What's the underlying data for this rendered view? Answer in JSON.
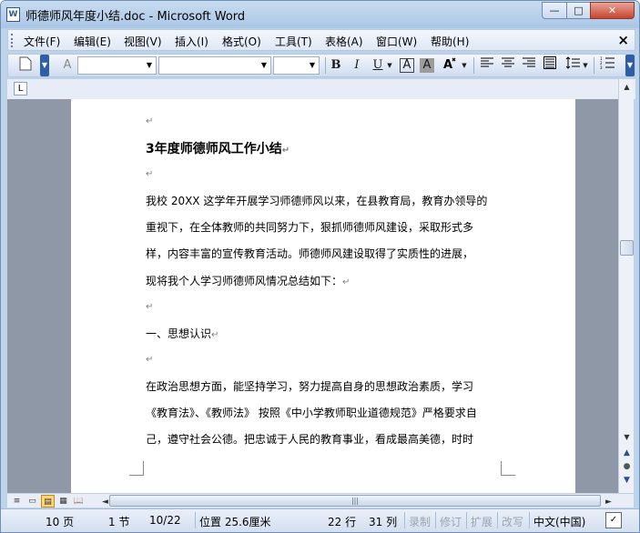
{
  "window": {
    "title": "师德师风年度小结.doc - Microsoft Word",
    "app_icon": "W",
    "minimize": "—",
    "maximize": "□",
    "close": "✕"
  },
  "menubar": {
    "items": [
      "文件(F)",
      "编辑(E)",
      "视图(V)",
      "插入(I)",
      "格式(O)",
      "工具(T)",
      "表格(A)",
      "窗口(W)",
      "帮助(H)"
    ],
    "close": "×"
  },
  "toolbar": {
    "style_value": "",
    "font_value": "",
    "size_value": "",
    "bold": "B",
    "italic": "I",
    "underline": "U",
    "char_border": "A",
    "char_shading": "A",
    "highlight": "A",
    "align_left": "≡",
    "align_center": "≡",
    "align_right": "≡",
    "justify": "≣",
    "line_spacing": "↕",
    "numbering": "☰"
  },
  "ruler": {
    "tab_selector": "L"
  },
  "document": {
    "lines": [
      {
        "text": "",
        "mark": "↵"
      },
      {
        "text": "3年度师德师风工作小结",
        "mark": "↵",
        "heading": true
      },
      {
        "text": "",
        "mark": "↵"
      },
      {
        "text": "我校 20XX 这学年开展学习师德师风以来，在县教育局，教育办领导的",
        "mark": ""
      },
      {
        "text": "重视下，在全体教师的共同努力下，狠抓师德师风建设，采取形式多",
        "mark": ""
      },
      {
        "text": "样，内容丰富的宣传教育活动。师德师风建设取得了实质性的进展，",
        "mark": ""
      },
      {
        "text": "现将我个人学习师德师风情况总结如下：",
        "mark": "↵"
      },
      {
        "text": "",
        "mark": "↵"
      },
      {
        "text": "一、思想认识",
        "mark": "↵"
      },
      {
        "text": "",
        "mark": "↵"
      },
      {
        "text": "在政治思想方面，能坚持学习，努力提高自身的思想政治素质，学习",
        "mark": ""
      },
      {
        "text": "《教育法》、《教师法》 按照《中小学教师职业道德规范》严格要求自",
        "mark": ""
      },
      {
        "text": "己，遵守社会公德。把忠诚于人民的教育事业，看成最高美德，时时",
        "mark": ""
      }
    ]
  },
  "scrollbar": {
    "up": "▲",
    "down": "▼",
    "prev_page": "▲",
    "select_browse": "●",
    "next_page": "▼"
  },
  "hscroll": {
    "left": "◄",
    "right": "►",
    "grip": "|||"
  },
  "view_buttons": [
    "≡",
    "▭",
    "▤",
    "▦",
    "📖"
  ],
  "statusbar": {
    "page": "10 页",
    "section": "1 节",
    "page_of": "10/22",
    "position": "位置 25.6厘米",
    "line": "22 行",
    "column": "31 列",
    "rec": "录制",
    "trk": "修订",
    "ext": "扩展",
    "ovr": "改写",
    "language": "中文(中国)",
    "spelling_icon": "✓"
  }
}
